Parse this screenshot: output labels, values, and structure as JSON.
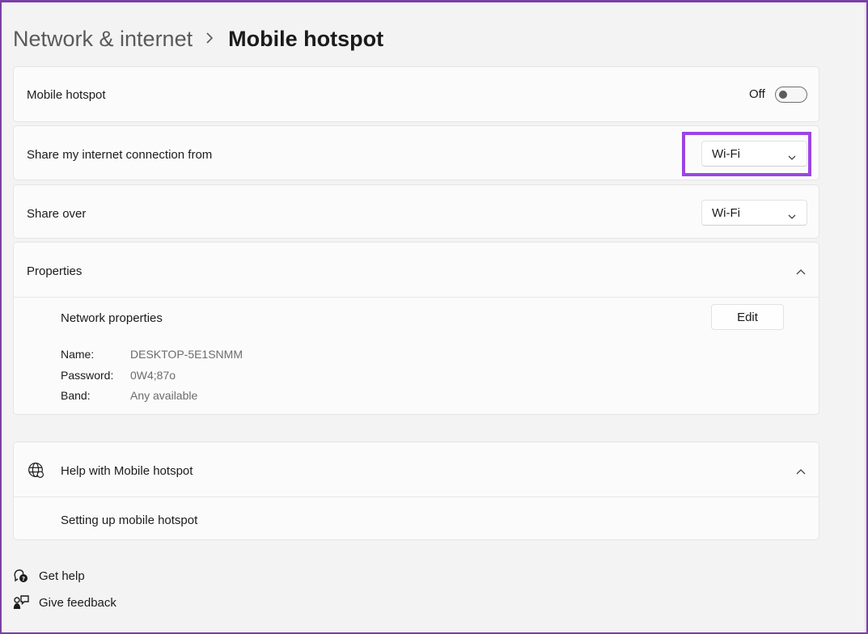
{
  "breadcrumb": {
    "parent": "Network & internet",
    "current": "Mobile hotspot"
  },
  "hotspot": {
    "label": "Mobile hotspot",
    "toggle_text": "Off",
    "toggle_on": false
  },
  "share_from": {
    "label": "Share my internet connection from",
    "value": "Wi-Fi"
  },
  "share_over": {
    "label": "Share over",
    "value": "Wi-Fi"
  },
  "properties": {
    "title": "Properties",
    "network_properties_label": "Network properties",
    "edit_label": "Edit",
    "name_key": "Name:",
    "name_value": "DESKTOP-5E1SNMM",
    "password_key": "Password:",
    "password_value": "0W4;87o",
    "band_key": "Band:",
    "band_value": "Any available"
  },
  "help": {
    "title": "Help with Mobile hotspot",
    "link": "Setting up mobile hotspot"
  },
  "footer": {
    "get_help": "Get help",
    "give_feedback": "Give feedback"
  },
  "icons": {
    "toggle": "toggle-switch-icon",
    "dropdown": "chevron-down-icon",
    "collapse": "chevron-up-icon",
    "help": "globe-icon",
    "get_help": "get-help-icon",
    "feedback": "feedback-icon"
  },
  "colors": {
    "accent": "#0067c0",
    "highlight": "#9b45e4",
    "window_border": "#7b3fa6"
  }
}
